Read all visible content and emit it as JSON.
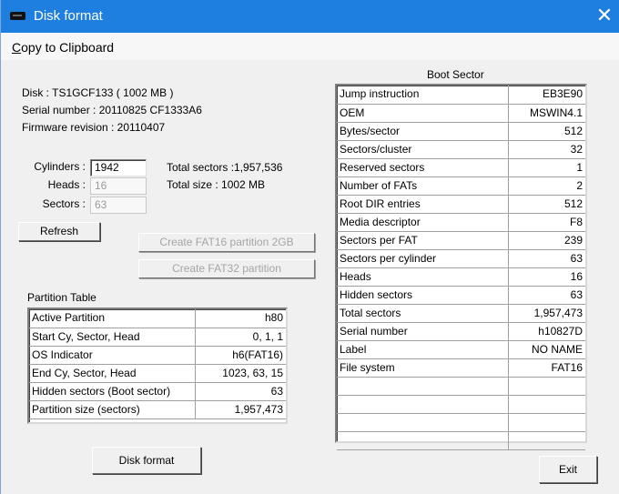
{
  "window": {
    "title": "Disk format",
    "close_glyph": "✕"
  },
  "menu": {
    "copy_label": "Copy to Clipboard"
  },
  "disk_info": {
    "disk": "Disk : TS1GCF133 ( 1002 MB )",
    "serial": "Serial number : 20110825    CF1333A6",
    "firmware": "Firmware revision : 20110407"
  },
  "geometry": {
    "cylinders_label": "Cylinders :",
    "cylinders_value": "1942",
    "heads_label": "Heads :",
    "heads_value": "16",
    "sectors_label": "Sectors :",
    "sectors_value": "63",
    "total_sectors": "Total sectors :1,957,536",
    "total_size": "Total size : 1002 MB"
  },
  "buttons": {
    "refresh": "Refresh",
    "create_fat16": "Create FAT16 partition 2GB",
    "create_fat32": "Create FAT32 partition",
    "disk_format": "Disk format",
    "exit": "Exit"
  },
  "partition_table": {
    "title": "Partition Table",
    "rows": [
      {
        "label": "Active Partition",
        "value": "h80"
      },
      {
        "label": "Start Cy, Sector, Head",
        "value": "0, 1, 1"
      },
      {
        "label": "OS Indicator",
        "value": "h6(FAT16)"
      },
      {
        "label": "End Cy, Sector, Head",
        "value": "1023, 63, 15"
      },
      {
        "label": "Hidden sectors (Boot sector)",
        "value": "63"
      },
      {
        "label": "Partition size (sectors)",
        "value": "1,957,473"
      }
    ]
  },
  "boot_sector": {
    "title": "Boot Sector",
    "rows": [
      {
        "label": "Jump instruction",
        "value": "EB3E90"
      },
      {
        "label": "OEM",
        "value": "MSWIN4.1"
      },
      {
        "label": "Bytes/sector",
        "value": "512"
      },
      {
        "label": "Sectors/cluster",
        "value": "32"
      },
      {
        "label": "Reserved sectors",
        "value": "1"
      },
      {
        "label": "Number of FATs",
        "value": "2"
      },
      {
        "label": "Root DIR entries",
        "value": "512"
      },
      {
        "label": "Media descriptor",
        "value": "F8"
      },
      {
        "label": "Sectors per FAT",
        "value": "239"
      },
      {
        "label": "Sectors per cylinder",
        "value": "63"
      },
      {
        "label": "Heads",
        "value": "16"
      },
      {
        "label": "Hidden sectors",
        "value": "63"
      },
      {
        "label": "Total sectors",
        "value": "1,957,473"
      },
      {
        "label": "Serial number",
        "value": "h10827D"
      },
      {
        "label": "Label",
        "value": "NO NAME"
      },
      {
        "label": "File system",
        "value": "FAT16"
      },
      {
        "label": "",
        "value": ""
      },
      {
        "label": "",
        "value": ""
      },
      {
        "label": "",
        "value": ""
      },
      {
        "label": "",
        "value": ""
      }
    ]
  }
}
